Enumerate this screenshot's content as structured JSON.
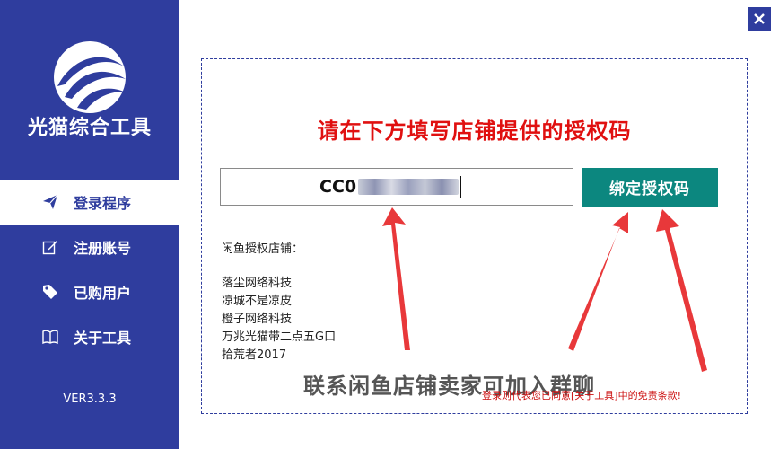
{
  "sidebar": {
    "app_title": "光猫综合工具",
    "version": "VER3.3.3",
    "items": [
      {
        "label": "登录程序",
        "icon": "send-icon",
        "active": true
      },
      {
        "label": "注册账号",
        "icon": "edit-icon",
        "active": false
      },
      {
        "label": "已购用户",
        "icon": "tag-icon",
        "active": false
      },
      {
        "label": "关于工具",
        "icon": "book-icon",
        "active": false
      }
    ]
  },
  "main": {
    "headline": "请在下方填写店铺提供的授权码",
    "code_value": "CC0",
    "bind_button": "绑定授权码",
    "shop_label": "闲鱼授权店铺：",
    "shops": [
      "落尘网络科技",
      "凉城不是凉皮",
      "橙子网络科技",
      "万兆光猫带二点五G口",
      "拾荒者2017"
    ],
    "big_text": "联系闲鱼店铺卖家可加入群聊",
    "agreement": "登录则代表您已同意[关于工具]中的免责条款!"
  },
  "colors": {
    "sidebar_bg": "#2f3d9e",
    "headline": "#e01010",
    "bind_button": "#0c877f",
    "arrow": "#e8383a"
  }
}
